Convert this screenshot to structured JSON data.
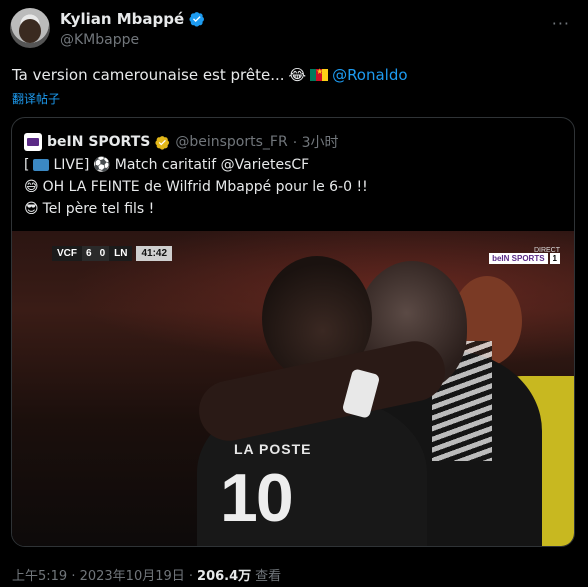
{
  "tweet": {
    "display_name": "Kylian Mbappé",
    "handle": "@KMbappe",
    "text": "Ta version camerounaise est prête...",
    "mention": "@Ronaldo",
    "translate": "翻译帖子",
    "more_label": "···"
  },
  "quote": {
    "name": "beIN SPORTS",
    "handle": "@beinsports_FR",
    "time": "· 3小时",
    "line1_prefix": "[",
    "line1": "LIVE]",
    "line1_rest": "Match caritatif @VarietesCF",
    "line2": "OH LA FEINTE de Wilfrid Mbappé pour le 6-0 !!",
    "line3": "Tel père tel fils !"
  },
  "video": {
    "team1": "VCF",
    "score1": "6",
    "score2": "0",
    "team2": "LN",
    "clock": "41:42",
    "direct": "DIRECT",
    "channel_a": "beIN SPORTS",
    "channel_b": "1",
    "jersey_sponsor": "LA POSTE",
    "jersey_number": "10"
  },
  "meta": {
    "time": "上午5:19 · 2023年10月19日 ·",
    "views": "206.4万",
    "views_label": "查看"
  },
  "colors": {
    "accent": "#1d9bf0",
    "muted": "#71767b",
    "background": "#000000"
  }
}
